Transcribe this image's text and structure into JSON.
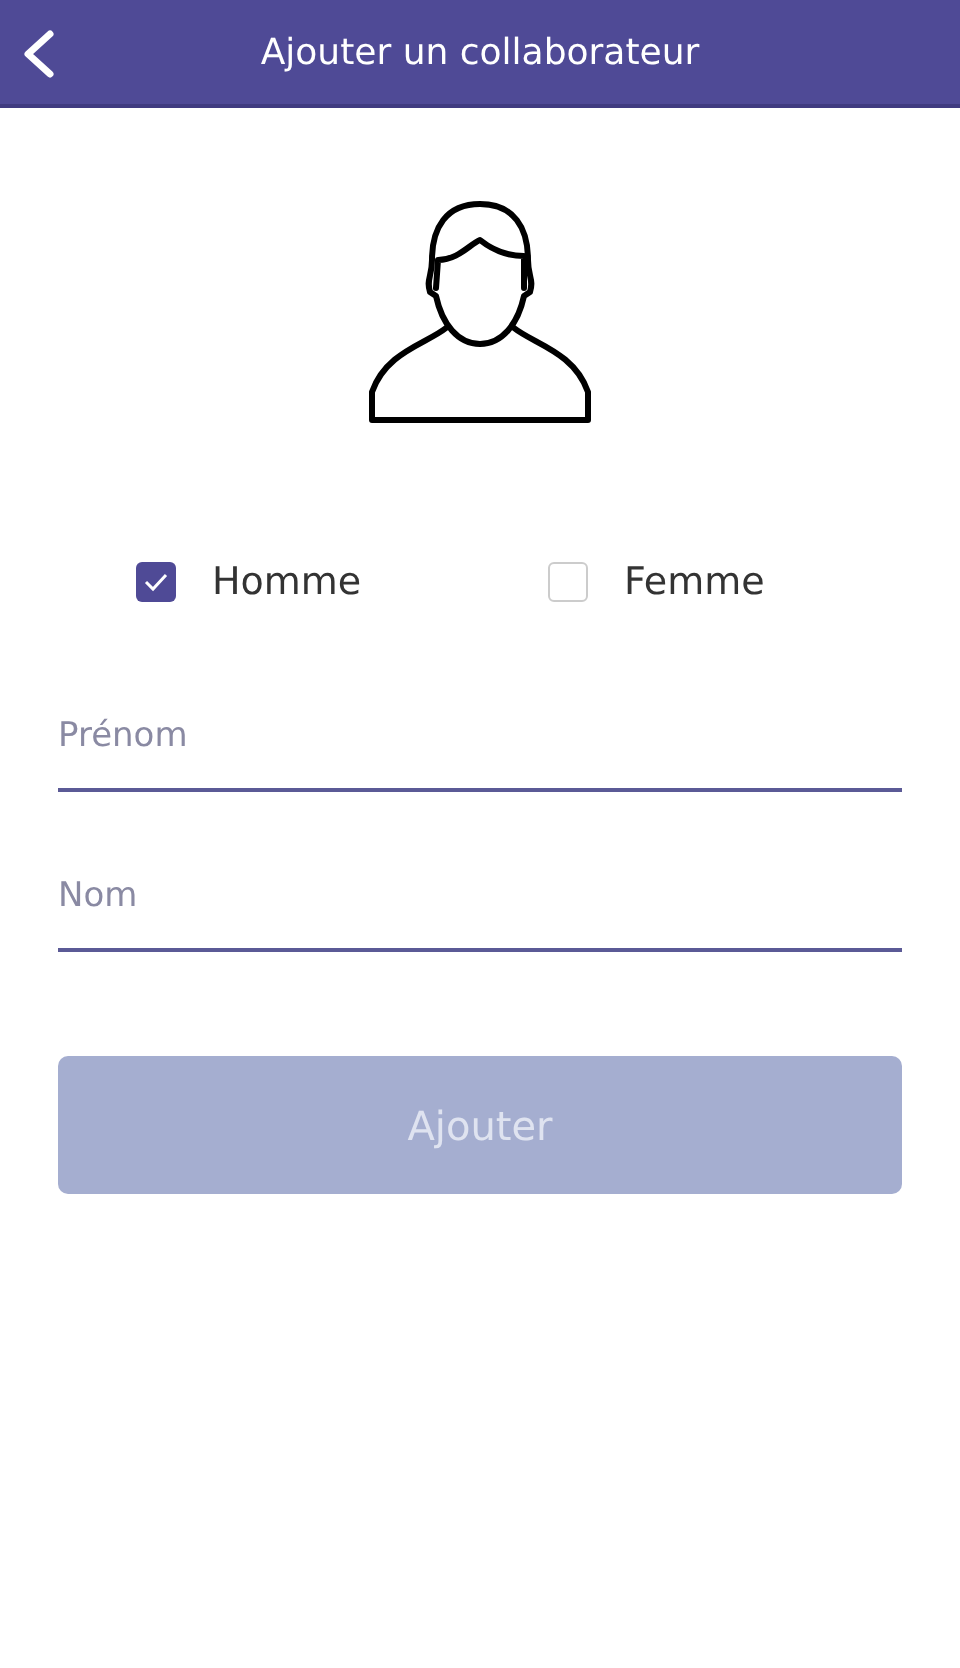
{
  "header": {
    "title": "Ajouter un collaborateur"
  },
  "gender_options": [
    {
      "label": "Homme",
      "checked": true
    },
    {
      "label": "Femme",
      "checked": false
    }
  ],
  "fields": [
    {
      "placeholder": "Prénom"
    },
    {
      "placeholder": "Nom"
    }
  ],
  "submit": {
    "label": "Ajouter",
    "disabled": true
  }
}
